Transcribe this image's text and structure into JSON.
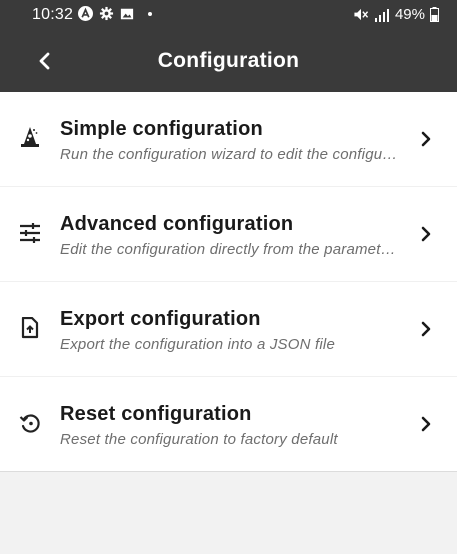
{
  "status_bar": {
    "time": "10:32",
    "battery": "49%",
    "icons_left": [
      "app-icon",
      "gear-icon",
      "image-icon"
    ],
    "icons_right": [
      "mute-icon",
      "signal-icon",
      "battery-icon"
    ]
  },
  "app_bar": {
    "title": "Configuration",
    "back_icon": "chevron-left-icon"
  },
  "menu": {
    "items": [
      {
        "title": "Simple configuration",
        "subtitle": "Run the configuration wizard to edit the configuration",
        "icon": "wizard-icon"
      },
      {
        "title": "Advanced configuration",
        "subtitle": "Edit the configuration directly from the parameters",
        "icon": "sliders-icon"
      },
      {
        "title": "Export configuration",
        "subtitle": "Export the configuration into a JSON file",
        "icon": "file-upload-icon"
      },
      {
        "title": "Reset configuration",
        "subtitle": "Reset the configuration to factory default",
        "icon": "restore-icon"
      }
    ]
  },
  "colors": {
    "topbar": "#3a3a3a",
    "background": "#f2f2f2",
    "list_background": "#ffffff",
    "title_text": "#1a1a1a",
    "subtitle_text": "#6e6e6e"
  }
}
